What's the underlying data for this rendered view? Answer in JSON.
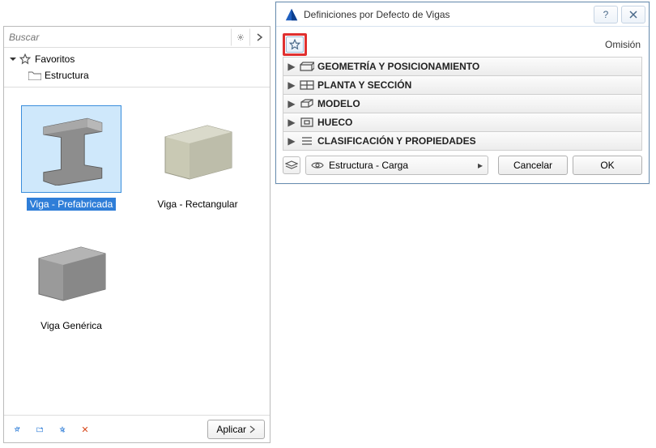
{
  "left": {
    "search_placeholder": "Buscar",
    "tree": {
      "root_label": "Favoritos",
      "child_label": "Estructura"
    },
    "thumbs": [
      {
        "label": "Viga - Prefabricada",
        "selected": true
      },
      {
        "label": "Viga - Rectangular",
        "selected": false
      },
      {
        "label": "Viga Genérica",
        "selected": false
      }
    ],
    "apply_label": "Aplicar"
  },
  "dialog": {
    "title": "Definiciones por Defecto de Vigas",
    "omision_label": "Omisión",
    "sections": [
      "GEOMETRÍA Y POSICIONAMIENTO",
      "PLANTA Y SECCIÓN",
      "MODELO",
      "HUECO",
      "CLASIFICACIÓN Y PROPIEDADES"
    ],
    "layer_label": "Estructura - Carga",
    "cancel_label": "Cancelar",
    "ok_label": "OK"
  }
}
